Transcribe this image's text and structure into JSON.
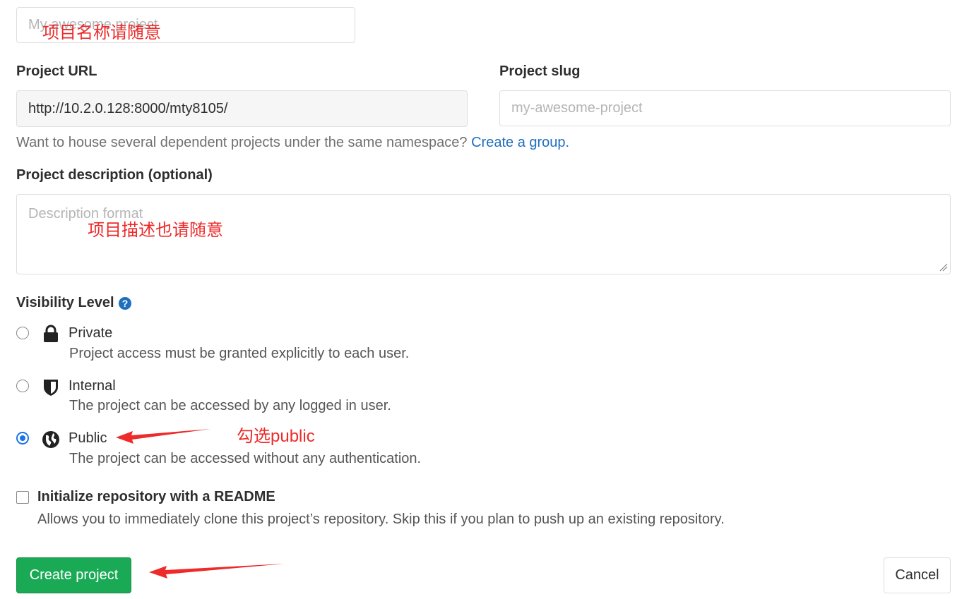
{
  "project_name": {
    "placeholder": "My awesome project",
    "annotation": "项目名称请随意"
  },
  "project_url": {
    "label": "Project URL",
    "value": "http://10.2.0.128:8000/mty8105/"
  },
  "project_slug": {
    "label": "Project slug",
    "placeholder": "my-awesome-project"
  },
  "group_help": {
    "text": "Want to house several dependent projects under the same namespace?",
    "link": "Create a group."
  },
  "description": {
    "label": "Project description (optional)",
    "placeholder": "Description format",
    "annotation": "项目描述也请随意"
  },
  "visibility": {
    "label": "Visibility Level",
    "help_icon": "question-circle-icon",
    "options": [
      {
        "title": "Private",
        "desc": "Project access must be granted explicitly to each user.",
        "icon": "lock-icon",
        "checked": false
      },
      {
        "title": "Internal",
        "desc": "The project can be accessed by any logged in user.",
        "icon": "shield-icon",
        "checked": false
      },
      {
        "title": "Public",
        "desc": "The project can be accessed without any authentication.",
        "icon": "globe-icon",
        "checked": true
      }
    ],
    "annotation": "勾选public"
  },
  "readme": {
    "label": "Initialize repository with a README",
    "desc": "Allows you to immediately clone this project’s repository. Skip this if you plan to push up an existing repository.",
    "checked": false
  },
  "buttons": {
    "create": "Create project",
    "cancel": "Cancel"
  },
  "colors": {
    "primary": "#1aaa55",
    "link": "#1f6fbd",
    "annotation": "#ee2a2a"
  }
}
